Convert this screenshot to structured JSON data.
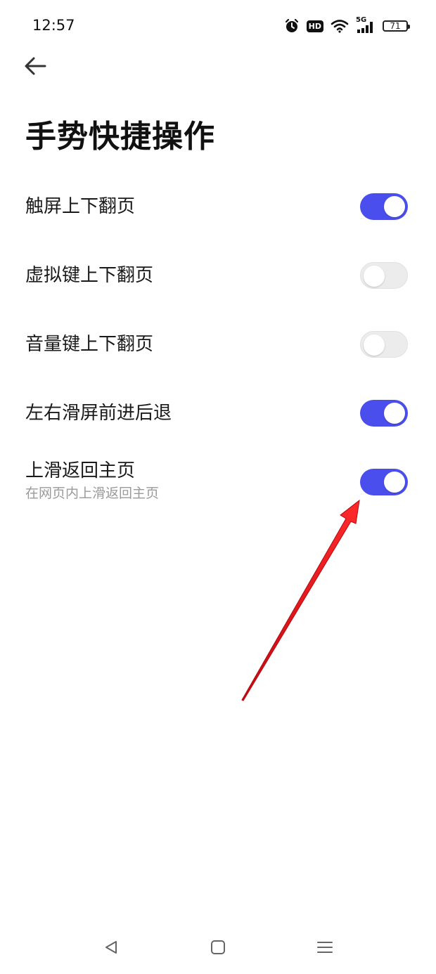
{
  "status_bar": {
    "time": "12:57",
    "icons": [
      "alarm-icon",
      "hd-icon",
      "wifi-icon",
      "cellular-5g-icon",
      "battery-icon"
    ],
    "hd_label": "HD",
    "network_label": "5G",
    "battery_level": "71"
  },
  "header": {
    "back_icon": "arrow-left-icon",
    "title": "手势快捷操作"
  },
  "settings": [
    {
      "label": "触屏上下翻页",
      "enabled": true
    },
    {
      "label": "虚拟键上下翻页",
      "enabled": false
    },
    {
      "label": "音量键上下翻页",
      "enabled": false
    },
    {
      "label": "左右滑屏前进后退",
      "enabled": true
    },
    {
      "label": "上滑返回主页",
      "sublabel": "在网页内上滑返回主页",
      "enabled": true
    }
  ],
  "colors": {
    "toggle_on": "#4a4eed",
    "toggle_off": "#ececec",
    "annotation_arrow": "#e8141b"
  },
  "nav_bar": {
    "icons": [
      "back-triangle-icon",
      "home-square-icon",
      "menu-lines-icon"
    ]
  }
}
